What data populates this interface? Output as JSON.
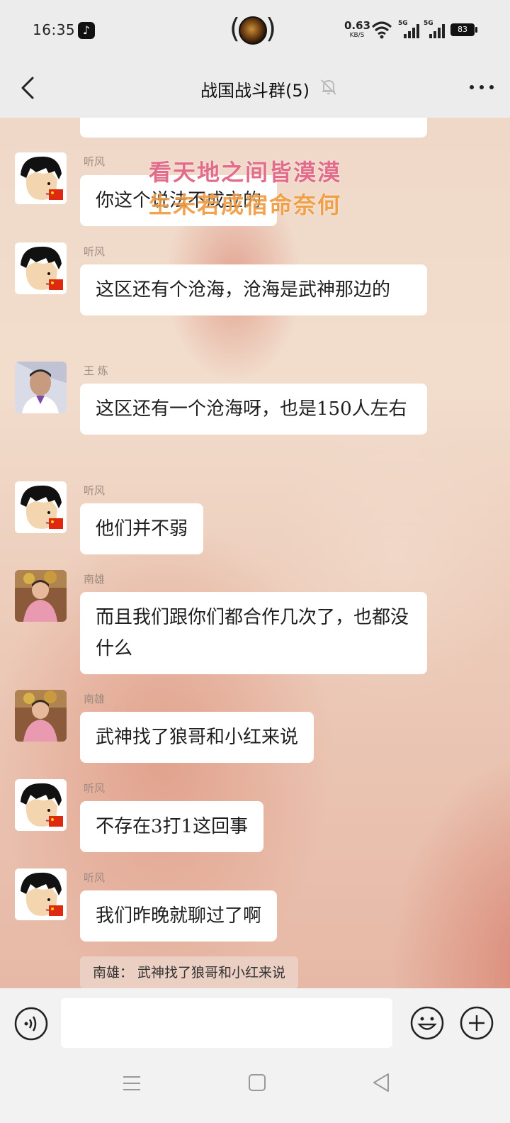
{
  "status_bar": {
    "time": "16:35",
    "net_speed": "0.63",
    "net_speed_unit": "KB/S",
    "sim1_label": "5G",
    "sim2_label": "5G",
    "battery": "83"
  },
  "header": {
    "title": "战国战斗群(5)"
  },
  "overlay": {
    "line1": "看天地之间皆漠漠",
    "line2": "生未若成宿命奈何"
  },
  "messages": [
    {
      "sender": "",
      "text": "",
      "avatar": "cartoon"
    },
    {
      "sender": "听风",
      "text": "你这个说法不成立的",
      "avatar": "cartoon"
    },
    {
      "sender": "听风",
      "text": "这区还有个沧海，沧海是武神那边的",
      "avatar": "cartoon"
    },
    {
      "sender": "王  炼",
      "text": "这区还有一个沧海呀，也是150人左右",
      "avatar": "photo-man"
    },
    {
      "sender": "听风",
      "text": "他们并不弱",
      "avatar": "cartoon"
    },
    {
      "sender": "南雄",
      "text": "而且我们跟你们都合作几次了，也都没什么",
      "avatar": "photo-girl"
    },
    {
      "sender": "南雄",
      "text": "武神找了狼哥和小红来说",
      "avatar": "photo-girl"
    },
    {
      "sender": "听风",
      "text": "不存在3打1这回事",
      "avatar": "cartoon"
    },
    {
      "sender": "听风",
      "text": "我们昨晚就聊过了啊",
      "avatar": "cartoon"
    }
  ],
  "quote": {
    "text": "南雄： 武神找了狼哥和小红来说"
  },
  "input": {
    "placeholder": ""
  },
  "colors": {
    "bubble": "#ffffff",
    "chat_bg": "#efd8c8",
    "header_bg": "#ececec"
  }
}
